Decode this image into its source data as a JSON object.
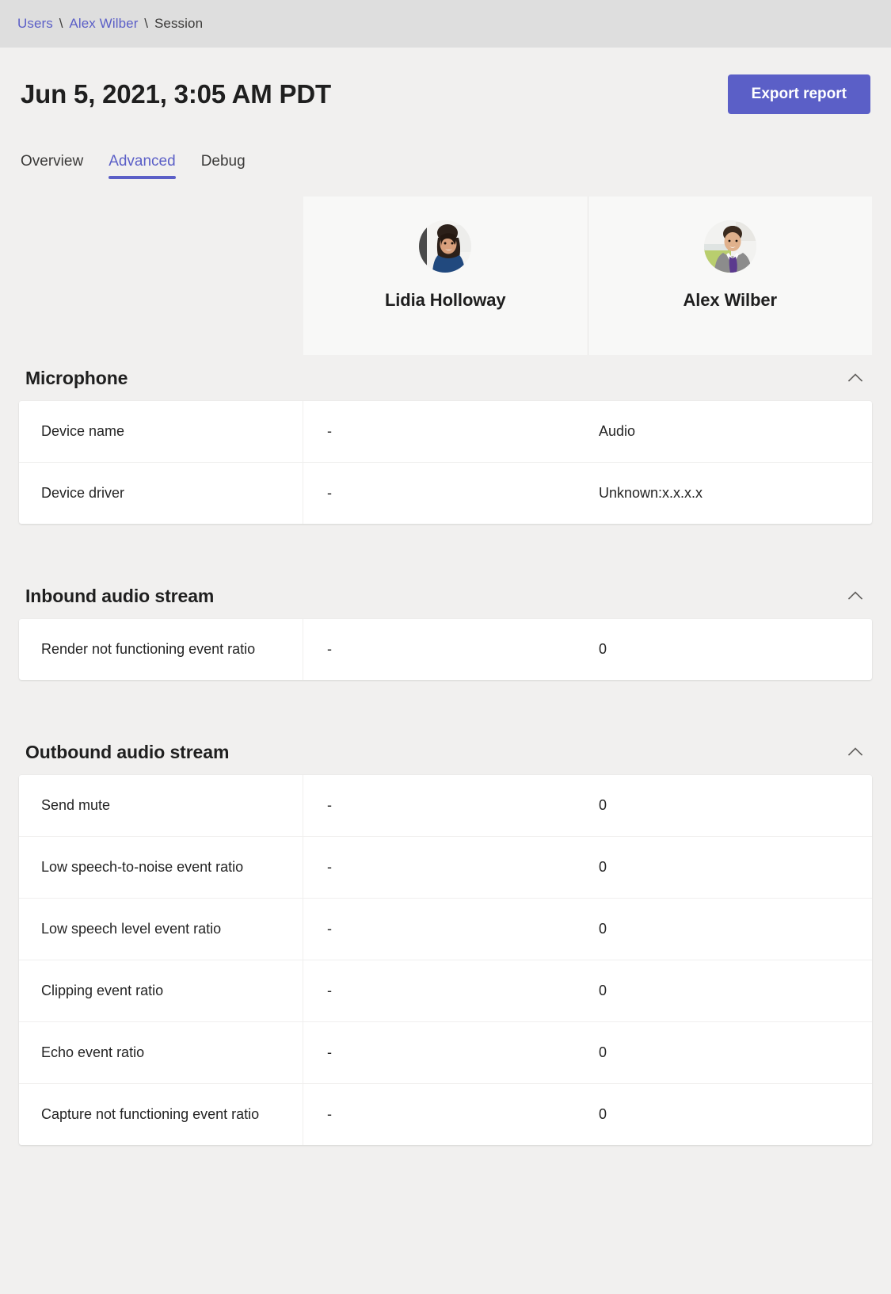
{
  "breadcrumb": {
    "items": [
      {
        "label": "Users",
        "is_link": true
      },
      {
        "label": "Alex Wilber",
        "is_link": true
      },
      {
        "label": "Session",
        "is_link": false
      }
    ],
    "separator": "\\"
  },
  "header": {
    "title": "Jun 5, 2021, 3:05 AM PDT",
    "export_label": "Export report",
    "accent_color": "#5B5FC7"
  },
  "tabs": [
    {
      "label": "Overview",
      "active": false
    },
    {
      "label": "Advanced",
      "active": true
    },
    {
      "label": "Debug",
      "active": false
    }
  ],
  "participants": [
    {
      "name": "Lidia Holloway",
      "avatar": "avatar-lidia-holloway"
    },
    {
      "name": "Alex Wilber",
      "avatar": "avatar-alex-wilber"
    }
  ],
  "sections": [
    {
      "title": "Microphone",
      "expanded": true,
      "chevron": "chevron-up-icon",
      "rows": [
        {
          "label": "Device name",
          "value1": "-",
          "value2": "Audio"
        },
        {
          "label": "Device driver",
          "value1": "-",
          "value2": "Unknown:x.x.x.x"
        }
      ]
    },
    {
      "title": "Inbound audio stream",
      "expanded": true,
      "chevron": "chevron-up-icon",
      "rows": [
        {
          "label": "Render not functioning event ratio",
          "value1": "-",
          "value2": "0"
        }
      ]
    },
    {
      "title": "Outbound audio stream",
      "expanded": true,
      "chevron": "chevron-up-icon",
      "rows": [
        {
          "label": "Send mute",
          "value1": "-",
          "value2": "0"
        },
        {
          "label": "Low speech-to-noise event ratio",
          "value1": "-",
          "value2": "0"
        },
        {
          "label": "Low speech level event ratio",
          "value1": "-",
          "value2": "0"
        },
        {
          "label": "Clipping event ratio",
          "value1": "-",
          "value2": "0"
        },
        {
          "label": "Echo event ratio",
          "value1": "-",
          "value2": "0"
        },
        {
          "label": "Capture not functioning event ratio",
          "value1": "-",
          "value2": "0"
        }
      ]
    }
  ],
  "colors": {
    "page_background": "#F1F0EF",
    "breadcrumb_background": "#DEDEDE",
    "accent": "#5B5FC7",
    "table_background": "#FFFFFF",
    "card_background": "#F8F8F7",
    "text_primary": "#242424"
  }
}
